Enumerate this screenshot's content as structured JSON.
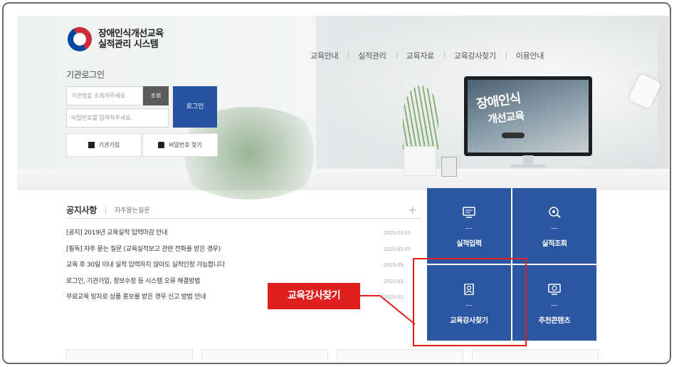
{
  "header": {
    "title_line1": "장애인식개선교육",
    "title_line2": "실적관리 시스템",
    "nav": [
      "교육안내",
      "실적관리",
      "교육자료",
      "교육강사찾기",
      "이용안내"
    ]
  },
  "login": {
    "title": "기관로그인",
    "id_placeholder": "기관명을 조회하주세요.",
    "check_label": "조회",
    "pw_placeholder": "비밀번호를 입력하주세요.",
    "login_label": "로그인",
    "join_label": "기관가입",
    "find_pw_label": "비밀번호 찾기"
  },
  "banner": {
    "line1": "장애인식",
    "line2": "개선교육"
  },
  "notice": {
    "tab_active": "공지사항",
    "tab_other": "자주묻는질문",
    "more": "+",
    "items": [
      {
        "text": "[공지] 2019년 교육실적 입력마감 안내",
        "date": "2020-03-13"
      },
      {
        "text": "[필독] 자주 묻는 질문 (교육실적보고 관련 전화를 받은 경우)",
        "date": "2020-01-07"
      },
      {
        "text": "교육 후 30일 이내 실적 입력하지 않아도 실적인정 가능합니다",
        "date": "2019-09-"
      },
      {
        "text": "로그인, 기관가입, 정보수정 등 시스템 오류 해결방법",
        "date": "2020-01-"
      },
      {
        "text": "무료교육 빙자로 상품 홍보를 받은 경우 신고 방법 안내",
        "date": "2020-01-"
      }
    ]
  },
  "tiles": [
    {
      "label": "실적입력",
      "icon": "monitor-icon"
    },
    {
      "label": "실적조회",
      "icon": "magnifier-icon"
    },
    {
      "label": "교육강사찾기",
      "icon": "instructor-icon"
    },
    {
      "label": "추천콘텐츠",
      "icon": "video-icon"
    }
  ],
  "callout": {
    "label": "교육강사찾기",
    "color": "#e01f1f"
  },
  "colors": {
    "primary_blue": "#2b56a1",
    "highlight_red": "#e21d1d"
  }
}
